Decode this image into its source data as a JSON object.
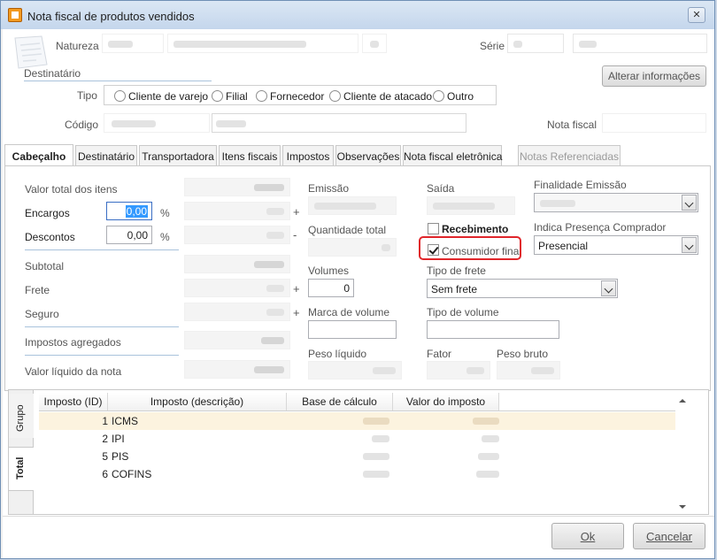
{
  "window": {
    "title": "Nota fiscal de produtos vendidos",
    "close_glyph": "✕"
  },
  "header": {
    "natureza_label": "Natureza",
    "serie_label": "Série",
    "destinatario_label": "Destinatário",
    "alterar_label": "Alterar informações",
    "tipo_label": "Tipo",
    "tipo_options": [
      "Cliente de varejo",
      "Filial",
      "Fornecedor",
      "Cliente de atacado",
      "Outro"
    ],
    "codigo_label": "Código",
    "nota_fiscal_label": "Nota fiscal"
  },
  "tabs": [
    {
      "label": "Cabeçalho",
      "state": "active"
    },
    {
      "label": "Destinatário",
      "state": "normal"
    },
    {
      "label": "Transportadora",
      "state": "normal"
    },
    {
      "label": "Itens fiscais",
      "state": "normal"
    },
    {
      "label": "Impostos",
      "state": "normal"
    },
    {
      "label": "Observações",
      "state": "normal"
    },
    {
      "label": "Nota fiscal eletrônica",
      "state": "normal"
    },
    {
      "label": "Notas Referenciadas",
      "state": "disabled"
    }
  ],
  "totals": {
    "valor_total_label": "Valor total dos itens",
    "encargos_label": "Encargos",
    "encargos_value": "0,00",
    "percent_sign": "%",
    "descontos_label": "Descontos",
    "descontos_value": "0,00",
    "subtotal_label": "Subtotal",
    "frete_label": "Frete",
    "seguro_label": "Seguro",
    "impostos_agregados_label": "Impostos agregados",
    "valor_liquido_label": "Valor líquido da nota",
    "plus_sign": "+",
    "minus_sign": "-"
  },
  "details": {
    "emissao_label": "Emissão",
    "saida_label": "Saída",
    "finalidade_label": "Finalidade Emissão",
    "quantidade_label": "Quantidade total",
    "recebimento_label": "Recebimento",
    "consumidor_final_label": "Consumidor final",
    "consumidor_final_checked": true,
    "recebimento_checked": false,
    "presenca_label": "Indica Presença Comprador",
    "presenca_value": "Presencial",
    "volumes_label": "Volumes",
    "volumes_value": "0",
    "tipo_frete_label": "Tipo de frete",
    "tipo_frete_value": "Sem frete",
    "marca_volume_label": "Marca de volume",
    "tipo_volume_label": "Tipo de volume",
    "peso_liquido_label": "Peso líquido",
    "fator_label": "Fator",
    "peso_bruto_label": "Peso bruto"
  },
  "grid": {
    "side_tabs": [
      "Grupo",
      "Total"
    ],
    "columns": [
      "Imposto (ID)",
      "Imposto (descrição)",
      "Base de cálculo",
      "Valor do imposto"
    ],
    "rows": [
      {
        "id": "1",
        "desc": "ICMS"
      },
      {
        "id": "2",
        "desc": "IPI"
      },
      {
        "id": "5",
        "desc": "PIS"
      },
      {
        "id": "6",
        "desc": "COFINS"
      }
    ]
  },
  "footer": {
    "ok_label": "Ok",
    "cancel_label": "Cancelar"
  }
}
